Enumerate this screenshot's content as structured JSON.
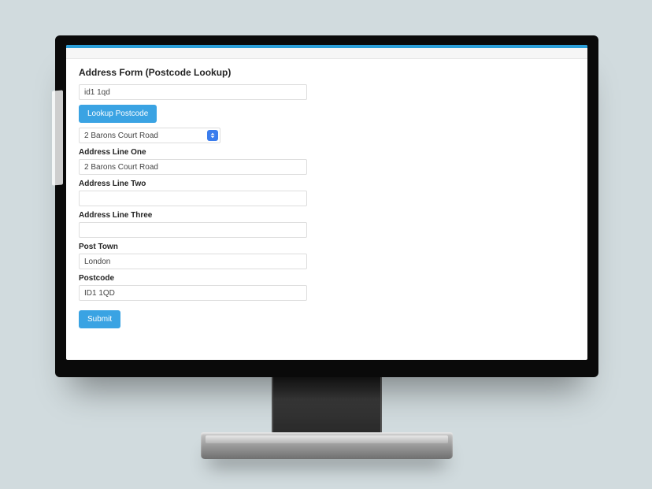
{
  "form": {
    "title": "Address Form (Postcode Lookup)",
    "lookup_input": "id1 1qd",
    "lookup_button": "Lookup Postcode",
    "address_select": "2 Barons Court Road",
    "labels": {
      "line1": "Address Line One",
      "line2": "Address Line Two",
      "line3": "Address Line Three",
      "town": "Post Town",
      "postcode": "Postcode"
    },
    "values": {
      "line1": "2 Barons Court Road",
      "line2": "",
      "line3": "",
      "town": "London",
      "postcode": "ID1 1QD"
    },
    "submit": "Submit"
  }
}
